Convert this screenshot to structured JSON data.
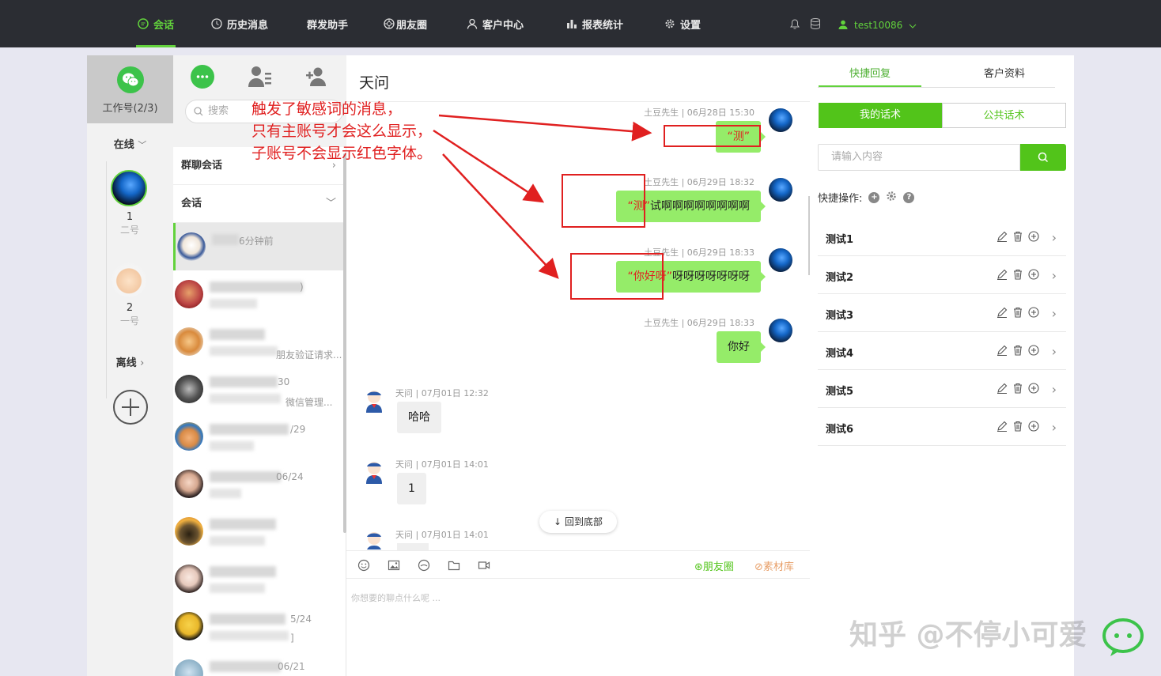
{
  "nav": {
    "items": [
      {
        "label": "会话",
        "icon": "chat-icon"
      },
      {
        "label": "历史消息",
        "icon": "clock-icon"
      },
      {
        "label": "群发助手",
        "icon": ""
      },
      {
        "label": "朋友圈",
        "icon": "aperture-icon"
      },
      {
        "label": "客户中心",
        "icon": "user-icon"
      },
      {
        "label": "报表统计",
        "icon": "bar-chart-icon"
      },
      {
        "label": "设置",
        "icon": "gear-icon"
      }
    ],
    "username": "test10086",
    "colors": {
      "accent": "#62d23c",
      "bar": "#2b2d33"
    }
  },
  "accounts": {
    "work_label": "工作号(2/3)",
    "online_label": "在线",
    "offline_label": "离线",
    "list": [
      {
        "num": "1",
        "name": "二号"
      },
      {
        "num": "2",
        "name": "一号"
      }
    ]
  },
  "sessions": {
    "search_placeholder": "搜索",
    "group_label": "群聊会话",
    "session_label": "会话",
    "items": [
      {
        "meta": "6分钟前",
        "meta2": ""
      },
      {
        "meta": ")",
        "meta2": ""
      },
      {
        "meta": "",
        "meta2": "朋友验证请求..."
      },
      {
        "meta": "30",
        "meta2": "微信管理..."
      },
      {
        "meta": "/29",
        "meta2": "测"
      },
      {
        "meta": "06/24",
        "meta2": "测"
      },
      {
        "meta": "",
        "meta2": "测"
      },
      {
        "meta": "",
        "meta2": "测"
      },
      {
        "meta": "5/24",
        "meta2": "]"
      },
      {
        "meta": "06/21",
        "meta2": ""
      }
    ]
  },
  "chat": {
    "title": "天问",
    "messages": [
      {
        "side": "right",
        "meta": "土豆先生 | 06月28日 15:30",
        "red": "“测”",
        "text": ""
      },
      {
        "side": "right",
        "meta": "土豆先生 | 06月29日 18:32",
        "red": "“测”",
        "text": "试啊啊啊啊啊啊啊啊"
      },
      {
        "side": "right",
        "meta": "土豆先生 | 06月29日 18:33",
        "red": "“你好呀”",
        "text": "呀呀呀呀呀呀呀"
      },
      {
        "side": "right",
        "meta": "土豆先生 | 06月29日 18:33",
        "red": "",
        "text": "你好"
      },
      {
        "side": "left",
        "meta": "天问 | 07月01日 12:32",
        "text": "哈哈"
      },
      {
        "side": "left",
        "meta": "天问 | 07月01日 14:01",
        "text": "1"
      },
      {
        "side": "left",
        "meta": "天问 | 07月01日 14:01",
        "text": ""
      }
    ],
    "back_to_bottom": "回到底部",
    "moments_link": "朋友圈",
    "library_link": "素材库",
    "input_placeholder": "你想要的聊点什么呢 ..."
  },
  "right": {
    "tabs": [
      "快捷回复",
      "客户资料"
    ],
    "segments": [
      "我的话术",
      "公共话术"
    ],
    "input_placeholder": "请输入内容",
    "quick_ops_label": "快捷操作:",
    "items": [
      "测试1",
      "测试2",
      "测试3",
      "测试4",
      "测试5",
      "测试6"
    ]
  },
  "annotation": {
    "lines": [
      "触发了敏感词的消息，",
      "只有主账号才会这么显示，",
      "子账号不会显示红色字体。"
    ],
    "color": "#e02020"
  },
  "watermark": "知乎 @不停小可爱"
}
